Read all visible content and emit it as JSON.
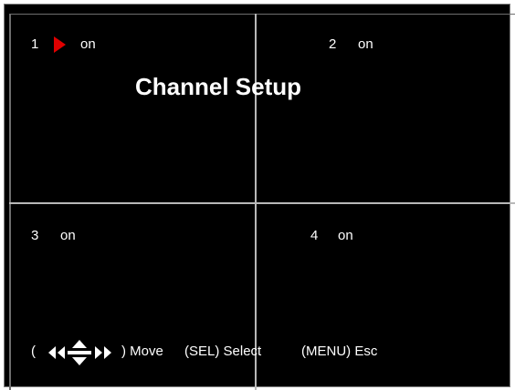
{
  "screen": {
    "title": "Channel Setup",
    "cursor_color": "#e00000",
    "cursor_icon": "play-arrow-icon",
    "channels": [
      {
        "number": "1",
        "status": "on",
        "selected": true
      },
      {
        "number": "2",
        "status": "on",
        "selected": false
      },
      {
        "number": "3",
        "status": "on",
        "selected": false
      },
      {
        "number": "4",
        "status": "on",
        "selected": false
      }
    ],
    "help": {
      "open_paren": "(",
      "nav_icons": [
        "left-double-arrow-icon",
        "up-down-arrow-icon",
        "right-double-arrow-icon"
      ],
      "move": ") Move",
      "select": "(SEL) Select",
      "esc": "(MENU) Esc"
    }
  }
}
